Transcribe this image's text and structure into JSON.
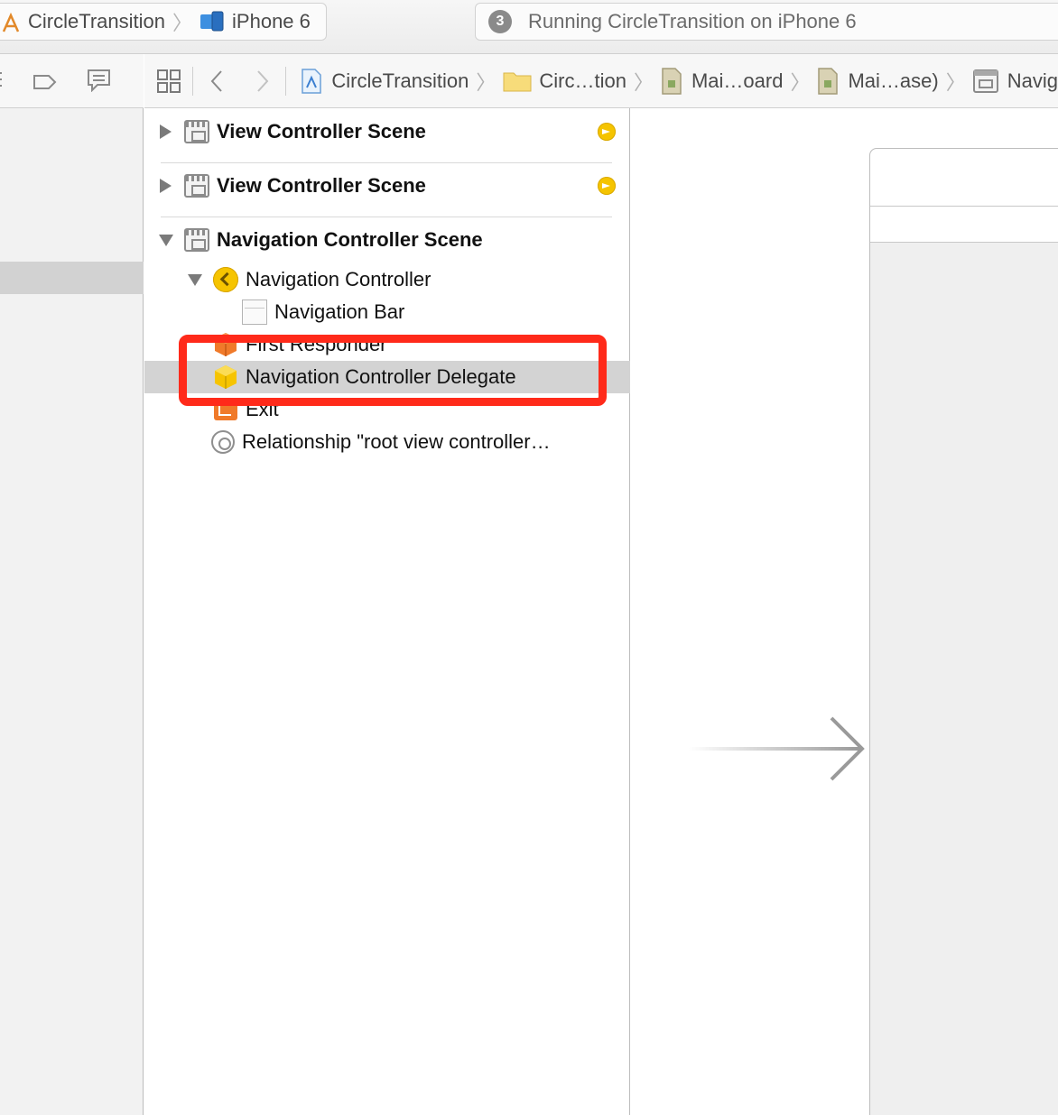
{
  "toolbar": {
    "scheme_name": "CircleTransition",
    "device_name": "iPhone 6",
    "status_badge": "3",
    "status_text": "Running CircleTransition on iPhone 6"
  },
  "navigator_icons": [
    "tag-icon",
    "comment-icon"
  ],
  "jump_bar": {
    "crumbs": [
      {
        "label": "CircleTransition",
        "icon": "project-file-icon"
      },
      {
        "label": "Circ…tion",
        "icon": "folder-icon"
      },
      {
        "label": "Mai…oard",
        "icon": "storyboard-file-icon"
      },
      {
        "label": "Mai…ase)",
        "icon": "storyboard-file-icon"
      },
      {
        "label": "Navig",
        "icon": "scene-icon"
      }
    ]
  },
  "outline": {
    "scene1": "View Controller Scene",
    "scene2": "View Controller Scene",
    "scene3": "Navigation Controller Scene",
    "nav_controller": "Navigation Controller",
    "nav_bar": "Navigation Bar",
    "first_responder": "First Responder",
    "delegate": "Navigation Controller Delegate",
    "exit": "Exit",
    "relationship": "Relationship \"root view controller…"
  },
  "colors": {
    "highlight": "#ff2a1a",
    "warning": "#f5c400",
    "exit": "#f07a2a"
  }
}
